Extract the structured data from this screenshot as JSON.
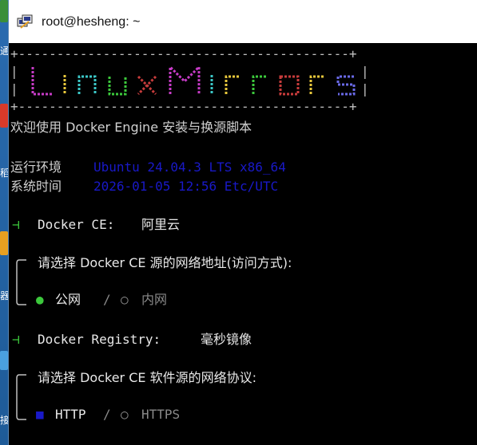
{
  "window": {
    "title": "root@hesheng: ~"
  },
  "desktop": {
    "labels": [
      "通",
      "稻",
      "器",
      "接"
    ]
  },
  "banner": {
    "border_top": "+-------------------------------------------+",
    "border_bottom": "+-------------------------------------------+",
    "logo_text": "LinuxMirrors",
    "colors": [
      "#c83cc8",
      "#e8c83c",
      "#3cc8c8",
      "#3cc83c",
      "#c83c3c",
      "#e8e8e8"
    ]
  },
  "welcome": "欢迎使用 Docker Engine 安装与换源脚本",
  "env": {
    "run_label": "运行环境",
    "run_value": "Ubuntu 24.04.3 LTS x86_64",
    "time_label": "系统时间",
    "time_value": "2026-01-05 12:56 Etc/UTC"
  },
  "steps": [
    {
      "marker": "⊣",
      "label": "Docker CE:",
      "value": "阿里云"
    },
    {
      "marker": "⊣",
      "label": "Docker Registry:",
      "value": "毫秒镜像"
    }
  ],
  "prompts": [
    {
      "question": "请选择 Docker CE 源的网络地址(访问方式):",
      "selected_bullet": "●",
      "selected": "公网",
      "separator": "/",
      "other_bullet": "○",
      "other": "内网"
    },
    {
      "question": "请选择 Docker CE 软件源的网络协议:",
      "selected_bullet": "■",
      "selected": "HTTP",
      "separator": "/",
      "other_bullet": "○",
      "other": "HTTPS"
    }
  ]
}
